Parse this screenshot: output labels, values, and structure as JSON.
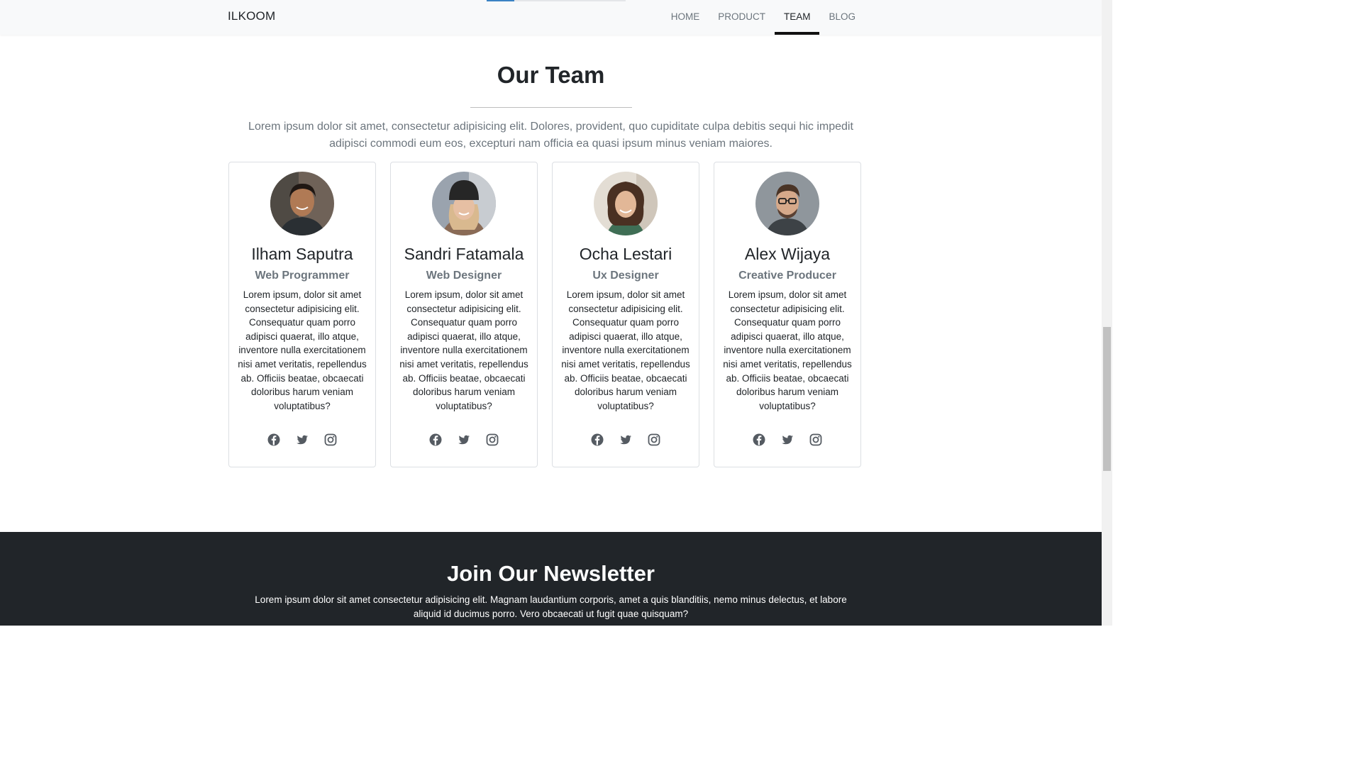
{
  "navbar": {
    "brand": "ILKOOM",
    "links": [
      {
        "label": "HOME",
        "active": false
      },
      {
        "label": "PRODUCT",
        "active": false
      },
      {
        "label": "TEAM",
        "active": true
      },
      {
        "label": "BLOG",
        "active": false
      }
    ],
    "scroll_progress_fraction": 0.2
  },
  "team": {
    "title": "Our Team",
    "lead": "Lorem ipsum dolor sit amet, consectetur adipisicing elit. Dolores, provident, quo cupiditate culpa debitis sequi hic impedit adipisci commodi eum eos, excepturi nam officia ea quasi ipsum minus veniam maiores.",
    "members": [
      {
        "name": "Ilham Saputra",
        "role": "Web Programmer",
        "bio": "Lorem ipsum, dolor sit amet consectetur adipisicing elit. Consequatur quam porro adipisci quaerat, illo atque, inventore nulla exercitationem nisi amet veritatis, repellendus ab. Officiis beatae, obcaecati doloribus harum veniam voluptatibus?",
        "avatar_icon": "avatar-man-photo-icon",
        "socials": [
          "facebook-icon",
          "twitter-icon",
          "instagram-icon"
        ]
      },
      {
        "name": "Sandri Fatamala",
        "role": "Web Designer",
        "bio": "Lorem ipsum, dolor sit amet consectetur adipisicing elit. Consequatur quam porro adipisci quaerat, illo atque, inventore nulla exercitationem nisi amet veritatis, repellendus ab. Officiis beatae, obcaecati doloribus harum veniam voluptatibus?",
        "avatar_icon": "avatar-woman-beanie-photo-icon",
        "socials": [
          "facebook-icon",
          "twitter-icon",
          "instagram-icon"
        ]
      },
      {
        "name": "Ocha Lestari",
        "role": "Ux Designer",
        "bio": "Lorem ipsum, dolor sit amet consectetur adipisicing elit. Consequatur quam porro adipisci quaerat, illo atque, inventore nulla exercitationem nisi amet veritatis, repellendus ab. Officiis beatae, obcaecati doloribus harum veniam voluptatibus?",
        "avatar_icon": "avatar-woman-curly-photo-icon",
        "socials": [
          "facebook-icon",
          "twitter-icon",
          "instagram-icon"
        ]
      },
      {
        "name": "Alex Wijaya",
        "role": "Creative Producer",
        "bio": "Lorem ipsum, dolor sit amet consectetur adipisicing elit. Consequatur quam porro adipisci quaerat, illo atque, inventore nulla exercitationem nisi amet veritatis, repellendus ab. Officiis beatae, obcaecati doloribus harum veniam voluptatibus?",
        "avatar_icon": "avatar-man-glasses-photo-icon",
        "socials": [
          "facebook-icon",
          "twitter-icon",
          "instagram-icon"
        ]
      }
    ]
  },
  "newsletter": {
    "title": "Join Our Newsletter",
    "text": "Lorem ipsum dolor sit amet consectetur adipisicing elit. Magnam laudantium corporis, amet a quis blanditiis, nemo minus delectus, et labore aliquid id ducimus porro. Vero obcaecati ut fugit quae quisquam?"
  },
  "colors": {
    "navbar_bg": "#f8f9fa",
    "nav_active_underline": "#111111",
    "muted_text": "#6c757d",
    "newsletter_bg": "#212529",
    "scroll_progress_fill": "#3b82c4"
  }
}
